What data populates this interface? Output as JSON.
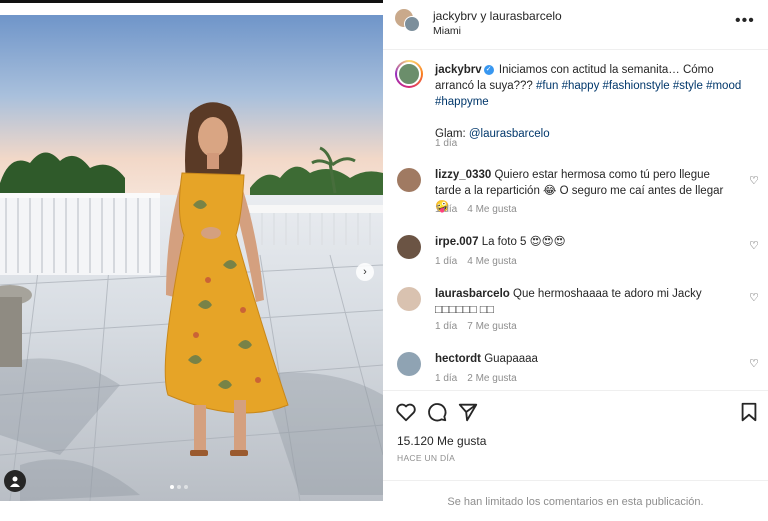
{
  "post": {
    "header": {
      "users": "jackybrv y laurasbarcelo",
      "location": "Miami",
      "more_icon": "more-horizontal-icon"
    },
    "caption": {
      "username": "jackybrv",
      "text": "Iniciamos con actitud la semanita… Cómo arrancó la suya???",
      "hashtags": "#fun #happy #fashionstyle #style #mood #happyme",
      "glam_label": "Glam:",
      "glam_user": "@laurasbarcelo",
      "time": "1 día"
    },
    "comments": [
      {
        "username": "lizzy_0330",
        "text": "Quiero estar hermosa como tú pero llegue tarde a la repartición 😂 O seguro me caí antes de llegar 🤪",
        "time": "1 día",
        "likes": "4 Me gusta"
      },
      {
        "username": "irpe.007",
        "text": "La foto 5 😍😍😍",
        "time": "1 día",
        "likes": "4 Me gusta"
      },
      {
        "username": "laurasbarcelo",
        "text": "Que hermoshaaaa te adoro mi Jacky □□□□□□ □□",
        "time": "1 día",
        "likes": "7 Me gusta"
      },
      {
        "username": "hectordt",
        "text": "Guapaaaa",
        "time": "1 día",
        "likes": "2 Me gusta"
      }
    ],
    "likes_count": "15.120 Me gusta",
    "posted_ago": "HACE UN DÍA",
    "comments_limited": "Se han limitado los comentarios en esta publicación."
  },
  "colors": {
    "link": "#00376b",
    "muted": "#8e8e8e",
    "verified": "#3897f0",
    "dress": "#e6a427"
  }
}
